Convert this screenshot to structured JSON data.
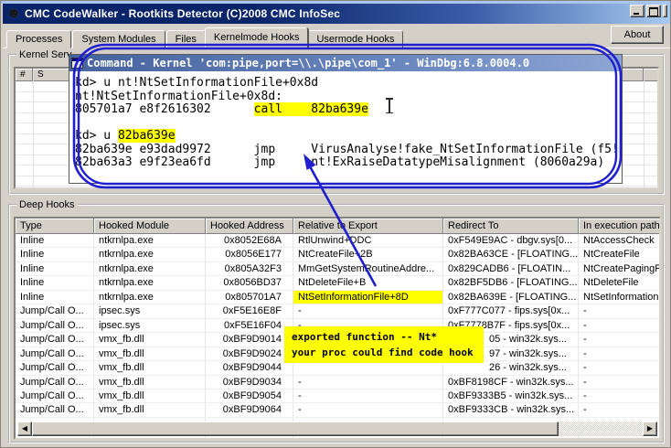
{
  "window": {
    "title": "CMC CodeWalker - Rootkits Detector (C)2008 CMC InfoSec"
  },
  "tabs": {
    "items": [
      {
        "label": "Processes"
      },
      {
        "label": "System Modules"
      },
      {
        "label": "Files"
      },
      {
        "label": "Kernelmode Hooks"
      },
      {
        "label": "Usermode Hooks"
      }
    ],
    "active_index": 3
  },
  "about_button": "About",
  "kernel_services": {
    "label": "Kernel Serv",
    "columns": [
      "#",
      "S"
    ]
  },
  "windbg": {
    "title": "Command - Kernel 'com:pipe,port=\\\\.\\pipe\\com_1' - WinDbg:6.8.0004.0",
    "highlight_color": "#ffff00",
    "lines": [
      [
        {
          "t": "kd> u nt!NtSetInformationFile+0x8d"
        }
      ],
      [
        {
          "t": "nt!NtSetInformationFile+0x8d:"
        }
      ],
      [
        {
          "t": "805701a7 e8f2616302      "
        },
        {
          "t": "call    82ba639e",
          "hl": true
        }
      ],
      [
        {
          "t": ""
        }
      ],
      [
        {
          "t": "kd> u "
        },
        {
          "t": "82ba639e",
          "hl": true
        }
      ],
      [
        {
          "t": "82ba639e e93dad9972      jmp     VirusAnalyse!fake_NtSetInformationFile (f5!"
        }
      ],
      [
        {
          "t": "82ba63a3 e9f23ea6fd      jmp     nt!ExRaiseDatatypeMisalignment (8060a29a)"
        }
      ]
    ]
  },
  "annotation": {
    "color": "#1f1fd0",
    "tooltip": {
      "bg": "#ffff00",
      "line1": "exported function -- Nt*",
      "line2": "your proc could find code hook"
    }
  },
  "deep_hooks": {
    "label": "Deep Hooks",
    "columns": [
      "Type",
      "Hooked Module",
      "Hooked Address",
      "Relative to Export",
      "Redirect To",
      "In execution path o"
    ],
    "rows": [
      {
        "type": "Inline",
        "module": "ntkrnlpa.exe",
        "address": "0x8052E68A",
        "relative": "RtlUnwind+DDC",
        "redirect": "0xF549E9AC - dbgv.sys[0...",
        "exec": "NtAccessCheck"
      },
      {
        "type": "Inline",
        "module": "ntkrnlpa.exe",
        "address": "0x8056E177",
        "relative": "NtCreateFile+2B",
        "redirect": "0x82BA63CE - [FLOATING...",
        "exec": "NtCreateFile"
      },
      {
        "type": "Inline",
        "module": "ntkrnlpa.exe",
        "address": "0x805A32F3",
        "relative": "MmGetSystemRoutineAddre...",
        "redirect": "0x829CADB6 - [FLOATIN...",
        "exec": "NtCreatePagingFile"
      },
      {
        "type": "Inline",
        "module": "ntkrnlpa.exe",
        "address": "0x8056BD37",
        "relative": "NtDeleteFile+B",
        "redirect": "0x82BF5DB6 - [FLOATING...",
        "exec": "NtDeleteFile"
      },
      {
        "type": "Inline",
        "module": "ntkrnlpa.exe",
        "address": "0x805701A7",
        "relative": "NtSetInformationFile+8D",
        "relative_highlight": true,
        "redirect": "0x82BA639E - [FLOATING...",
        "exec": "NtSetInformationFile"
      },
      {
        "type": "Jump/Call O...",
        "module": "ipsec.sys",
        "address": "0xF5E16E8F",
        "relative": "-",
        "redirect": "0xF777C077 - fips.sys[0x...",
        "exec": "-"
      },
      {
        "type": "Jump/Call O...",
        "module": "ipsec.sys",
        "address": "0xF5E16F04",
        "relative": "-",
        "redirect": "0xF7778B7F - fips.sys[0x...",
        "exec": "-"
      },
      {
        "type": "Jump/Call O...",
        "module": "vmx_fb.dll",
        "address": "0xBF9D9014",
        "relative": "",
        "redirect": "05 - win32k.sys...",
        "redirect_covered": true,
        "exec": "-"
      },
      {
        "type": "Jump/Call O...",
        "module": "vmx_fb.dll",
        "address": "0xBF9D9024",
        "relative": "",
        "redirect": "97 - win32k.sys...",
        "redirect_covered": true,
        "exec": "-"
      },
      {
        "type": "Jump/Call O...",
        "module": "vmx_fb.dll",
        "address": "0xBF9D9044",
        "relative": "",
        "redirect": "26 - win32k.sys...",
        "redirect_covered": true,
        "exec": "-"
      },
      {
        "type": "Jump/Call O...",
        "module": "vmx_fb.dll",
        "address": "0xBF9D9034",
        "relative": "-",
        "redirect": "0xBF8198CF - win32k.sys...",
        "exec": "-"
      },
      {
        "type": "Jump/Call O...",
        "module": "vmx_fb.dll",
        "address": "0xBF9D9054",
        "relative": "-",
        "redirect": "0xBF9333B5 - win32k.sys...",
        "exec": "-"
      },
      {
        "type": "Jump/Call O...",
        "module": "vmx_fb.dll",
        "address": "0xBF9D9064",
        "relative": "-",
        "redirect": "0xBF9333CB - win32k.sys...",
        "exec": "-"
      }
    ]
  }
}
